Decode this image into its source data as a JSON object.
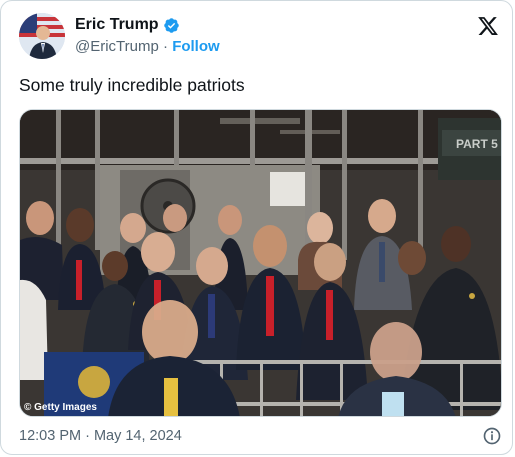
{
  "author": {
    "name": "Eric Trump",
    "handle": "@EricTrump",
    "separator": "·",
    "follow_label": "Follow",
    "verified_color": "#1d9bf0"
  },
  "tweet": {
    "text": "Some truly incredible patriots",
    "photo_credit": "© Getty Images",
    "sign_text": "PART 5"
  },
  "meta": {
    "timestamp": "12:03 PM · May 14, 2024"
  },
  "icons": {
    "platform": "x-logo-icon",
    "verified": "verified-badge-icon",
    "info": "info-icon"
  }
}
